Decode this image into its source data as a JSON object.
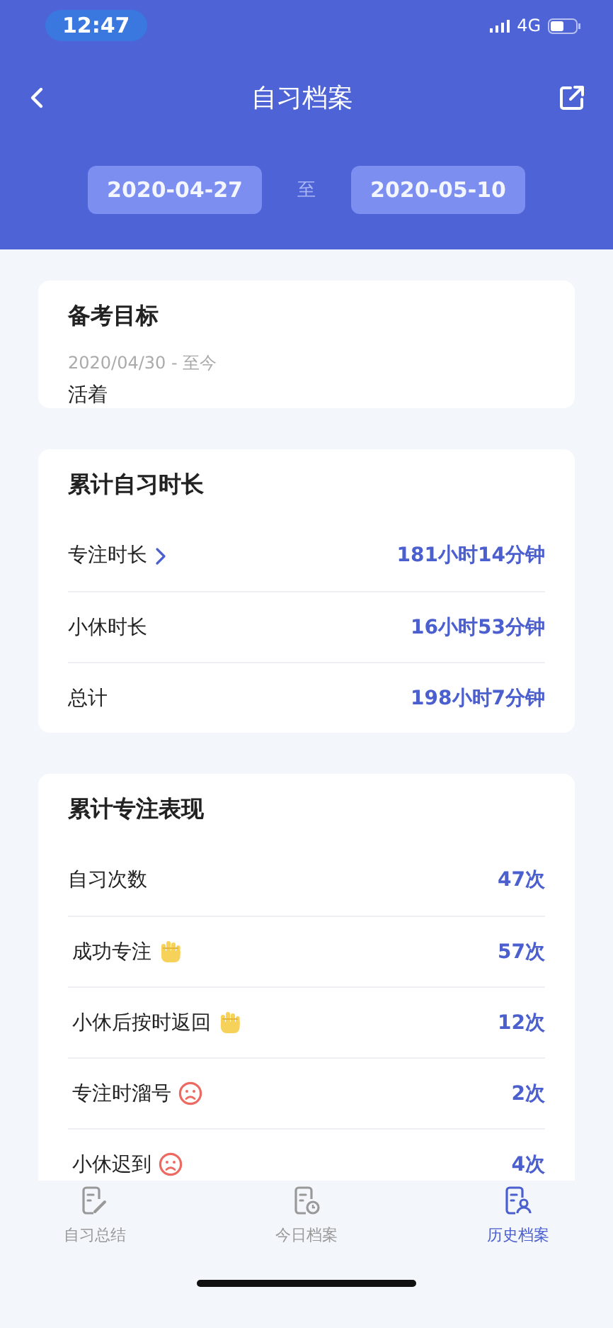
{
  "status_bar": {
    "time": "12:47",
    "network": "4G"
  },
  "header": {
    "title": "自习档案",
    "date_from": "2020-04-27",
    "separator": "至",
    "date_to": "2020-05-10"
  },
  "goal": {
    "title": "备考目标",
    "date": "2020/04/30 - 至今",
    "text": "活着"
  },
  "duration": {
    "title": "累计自习时长",
    "rows": [
      {
        "kind": "link",
        "label": "专注时长",
        "value": "181小时14分钟"
      },
      {
        "kind": "plain",
        "label": "小休时长",
        "value": "16小时53分钟"
      },
      {
        "kind": "plain",
        "label": "总计",
        "value": "198小时7分钟"
      }
    ]
  },
  "performance": {
    "title": "累计专注表现",
    "rows": [
      {
        "kind": "plain",
        "label": "自习次数",
        "value": "47次"
      },
      {
        "kind": "good",
        "label": "成功专注",
        "value": "57次"
      },
      {
        "kind": "good",
        "label": "小休后按时返回",
        "value": "12次"
      },
      {
        "kind": "bad",
        "label": "专注时溜号",
        "value": "2次"
      },
      {
        "kind": "bad",
        "label": "小休迟到",
        "value": "4次"
      }
    ]
  },
  "tab_bar": [
    {
      "kind": "summary",
      "label": "自习总结",
      "selected": false
    },
    {
      "kind": "today",
      "label": "今日档案",
      "selected": false
    },
    {
      "kind": "history",
      "label": "历史档案",
      "selected": true
    }
  ]
}
